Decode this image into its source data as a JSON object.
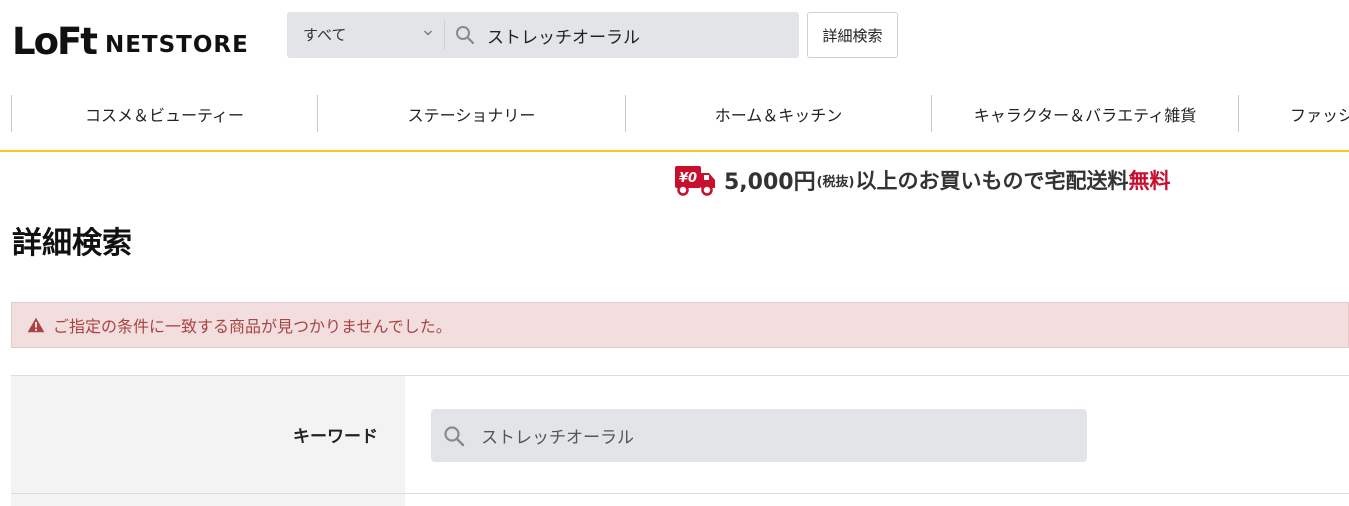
{
  "header": {
    "logo_main": "LoFt",
    "logo_sub": "NETSTORE",
    "search": {
      "category_selected": "すべて",
      "query": "ストレッチオーラル"
    },
    "advanced_search_label": "詳細検索"
  },
  "category_nav": {
    "items": [
      {
        "label": "コスメ＆ビューティー"
      },
      {
        "label": "ステーショナリー"
      },
      {
        "label": "ホーム＆キッチン"
      },
      {
        "label": "キャラクター＆バラエティ雑貨"
      },
      {
        "label": "ファッシ"
      }
    ]
  },
  "shipping_banner": {
    "badge": "¥0",
    "amount": "5,000円",
    "tax_note": "(税抜)",
    "text": "以上のお買いもので宅配送料",
    "free": "無料"
  },
  "page": {
    "title": "詳細検索"
  },
  "alert": {
    "message": "ご指定の条件に一致する商品が見つかりませんでした。"
  },
  "form": {
    "keyword_label": "キーワード",
    "keyword_value": "ストレッチオーラル"
  },
  "colors": {
    "accent_yellow": "#f3c921",
    "free_red": "#c8102e",
    "alert_bg": "#f2dede",
    "alert_text": "#a94442",
    "input_bg": "#e3e4e8"
  },
  "icons": {
    "search": "search-icon",
    "chevron": "chevron-down-icon",
    "warning": "warning-icon",
    "truck": "delivery-truck-icon"
  }
}
